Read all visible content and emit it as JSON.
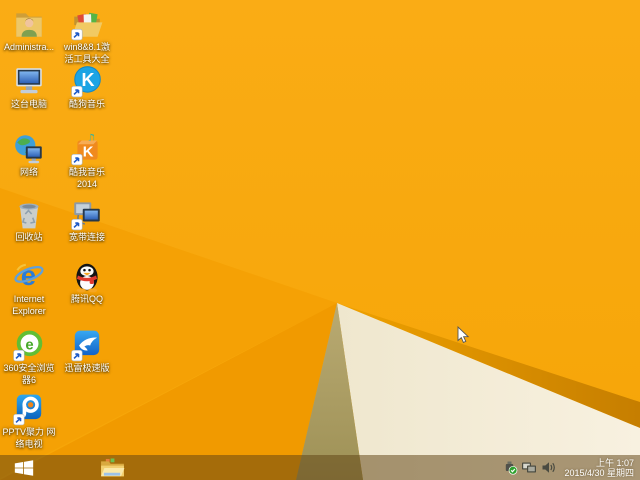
{
  "desktop": {
    "icons": [
      {
        "name": "administrator-folder",
        "label": "Administra..."
      },
      {
        "name": "win8-activation-tools-folder",
        "label": "win8&8.1激\n活工具大全"
      },
      {
        "name": "this-pc",
        "label": "这台电脑"
      },
      {
        "name": "kugou-music",
        "label": "酷狗音乐"
      },
      {
        "name": "network",
        "label": "网络"
      },
      {
        "name": "kuwo-music-2014",
        "label": "酷我音乐\n2014"
      },
      {
        "name": "recycle-bin",
        "label": "回收站"
      },
      {
        "name": "broadband-connection",
        "label": "宽带连接"
      },
      {
        "name": "internet-explorer",
        "label": "Internet\nExplorer"
      },
      {
        "name": "tencent-qq",
        "label": "腾讯QQ"
      },
      {
        "name": "360-safe-browser-6",
        "label": "360安全浏览\n器6"
      },
      {
        "name": "xunlei-thunder-speed",
        "label": "迅雷极速版"
      },
      {
        "name": "pptv-network-tv",
        "label": "PPTV聚力 网\n络电视"
      }
    ]
  },
  "taskbar": {
    "clock": {
      "time": "上午 1:07",
      "date": "2015/4/30 星期四"
    },
    "tray_icons": [
      "safely-remove-hardware",
      "network-status",
      "volume"
    ],
    "buttons": [
      "start",
      "file-explorer"
    ]
  },
  "colors": {
    "wallpaper_orange_top": "#FAAC15",
    "wallpaper_orange_bottom": "#F6A507",
    "wallpaper_cream_triangle": "#F6EFDC",
    "wallpaper_tan_shadow": "#AFA065",
    "wallpaper_dark_wedge": "#D98C00",
    "taskbar_tint": "rgba(95,67,20,0.52)",
    "icon_label_text": "#FFFFFF"
  }
}
